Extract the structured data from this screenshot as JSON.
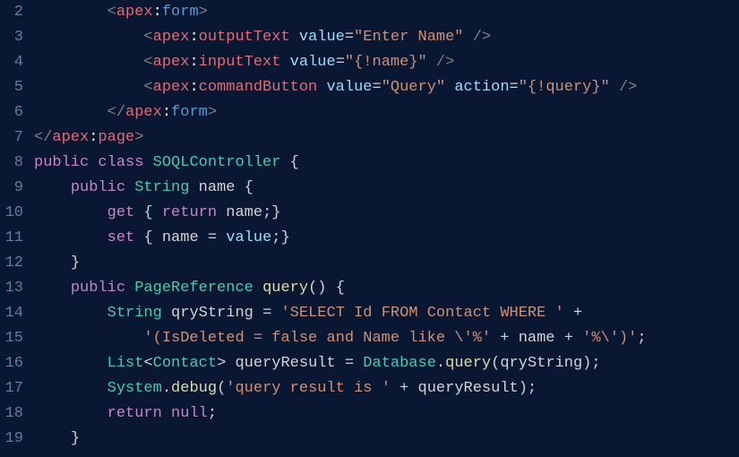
{
  "editor": {
    "startLine": 2,
    "lineCount": 18,
    "lines": {
      "l2": "        <apex:form>",
      "l3": "            <apex:outputText value=\"Enter Name\" />",
      "l4": "            <apex:inputText value=\"{!name}\" />",
      "l5": "            <apex:commandButton value=\"Query\" action=\"{!query}\" />",
      "l6": "        </apex:form>",
      "l7": "</apex:page>",
      "l8": "public class SOQLController {",
      "l9": "    public String name {",
      "l10": "        get { return name;}",
      "l11": "        set { name = value;}",
      "l12": "    }",
      "l13": "    public PageReference query() {",
      "l14": "        String qryString = 'SELECT Id FROM Contact WHERE ' +",
      "l15": "            '(IsDeleted = false and Name like \\'%' + name + '%\\')';",
      "l16": "        List<Contact> queryResult = Database.query(qryString);",
      "l17": "        System.debug('query result is ' + queryResult);",
      "l18": "        return null;",
      "l19": "    }"
    },
    "gutterNumbers": [
      "2",
      "3",
      "4",
      "5",
      "6",
      "7",
      "8",
      "9",
      "10",
      "11",
      "12",
      "13",
      "14",
      "15",
      "16",
      "17",
      "18",
      "19"
    ]
  }
}
